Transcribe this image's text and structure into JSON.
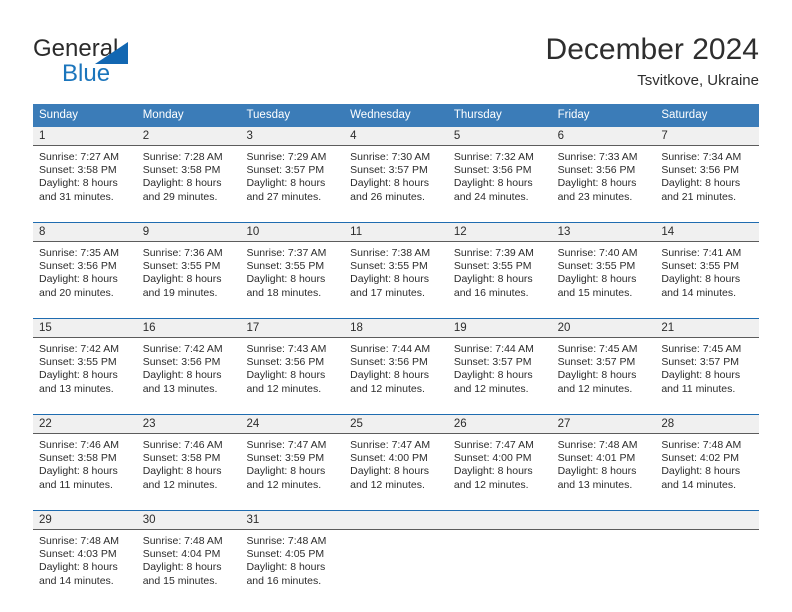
{
  "brand": {
    "name_top": "General",
    "name_bottom": "Blue",
    "accent_color": "#1b75bc",
    "triangle_color": "#1267b2"
  },
  "header": {
    "title": "December 2024",
    "location": "Tsvitkove, Ukraine"
  },
  "calendar": {
    "header_bg": "#3b7cb8",
    "weekdays": [
      "Sunday",
      "Monday",
      "Tuesday",
      "Wednesday",
      "Thursday",
      "Friday",
      "Saturday"
    ],
    "weeks": [
      [
        {
          "day": "1",
          "sunrise": "Sunrise: 7:27 AM",
          "sunset": "Sunset: 3:58 PM",
          "daylight1": "Daylight: 8 hours",
          "daylight2": "and 31 minutes."
        },
        {
          "day": "2",
          "sunrise": "Sunrise: 7:28 AM",
          "sunset": "Sunset: 3:58 PM",
          "daylight1": "Daylight: 8 hours",
          "daylight2": "and 29 minutes."
        },
        {
          "day": "3",
          "sunrise": "Sunrise: 7:29 AM",
          "sunset": "Sunset: 3:57 PM",
          "daylight1": "Daylight: 8 hours",
          "daylight2": "and 27 minutes."
        },
        {
          "day": "4",
          "sunrise": "Sunrise: 7:30 AM",
          "sunset": "Sunset: 3:57 PM",
          "daylight1": "Daylight: 8 hours",
          "daylight2": "and 26 minutes."
        },
        {
          "day": "5",
          "sunrise": "Sunrise: 7:32 AM",
          "sunset": "Sunset: 3:56 PM",
          "daylight1": "Daylight: 8 hours",
          "daylight2": "and 24 minutes."
        },
        {
          "day": "6",
          "sunrise": "Sunrise: 7:33 AM",
          "sunset": "Sunset: 3:56 PM",
          "daylight1": "Daylight: 8 hours",
          "daylight2": "and 23 minutes."
        },
        {
          "day": "7",
          "sunrise": "Sunrise: 7:34 AM",
          "sunset": "Sunset: 3:56 PM",
          "daylight1": "Daylight: 8 hours",
          "daylight2": "and 21 minutes."
        }
      ],
      [
        {
          "day": "8",
          "sunrise": "Sunrise: 7:35 AM",
          "sunset": "Sunset: 3:56 PM",
          "daylight1": "Daylight: 8 hours",
          "daylight2": "and 20 minutes."
        },
        {
          "day": "9",
          "sunrise": "Sunrise: 7:36 AM",
          "sunset": "Sunset: 3:55 PM",
          "daylight1": "Daylight: 8 hours",
          "daylight2": "and 19 minutes."
        },
        {
          "day": "10",
          "sunrise": "Sunrise: 7:37 AM",
          "sunset": "Sunset: 3:55 PM",
          "daylight1": "Daylight: 8 hours",
          "daylight2": "and 18 minutes."
        },
        {
          "day": "11",
          "sunrise": "Sunrise: 7:38 AM",
          "sunset": "Sunset: 3:55 PM",
          "daylight1": "Daylight: 8 hours",
          "daylight2": "and 17 minutes."
        },
        {
          "day": "12",
          "sunrise": "Sunrise: 7:39 AM",
          "sunset": "Sunset: 3:55 PM",
          "daylight1": "Daylight: 8 hours",
          "daylight2": "and 16 minutes."
        },
        {
          "day": "13",
          "sunrise": "Sunrise: 7:40 AM",
          "sunset": "Sunset: 3:55 PM",
          "daylight1": "Daylight: 8 hours",
          "daylight2": "and 15 minutes."
        },
        {
          "day": "14",
          "sunrise": "Sunrise: 7:41 AM",
          "sunset": "Sunset: 3:55 PM",
          "daylight1": "Daylight: 8 hours",
          "daylight2": "and 14 minutes."
        }
      ],
      [
        {
          "day": "15",
          "sunrise": "Sunrise: 7:42 AM",
          "sunset": "Sunset: 3:55 PM",
          "daylight1": "Daylight: 8 hours",
          "daylight2": "and 13 minutes."
        },
        {
          "day": "16",
          "sunrise": "Sunrise: 7:42 AM",
          "sunset": "Sunset: 3:56 PM",
          "daylight1": "Daylight: 8 hours",
          "daylight2": "and 13 minutes."
        },
        {
          "day": "17",
          "sunrise": "Sunrise: 7:43 AM",
          "sunset": "Sunset: 3:56 PM",
          "daylight1": "Daylight: 8 hours",
          "daylight2": "and 12 minutes."
        },
        {
          "day": "18",
          "sunrise": "Sunrise: 7:44 AM",
          "sunset": "Sunset: 3:56 PM",
          "daylight1": "Daylight: 8 hours",
          "daylight2": "and 12 minutes."
        },
        {
          "day": "19",
          "sunrise": "Sunrise: 7:44 AM",
          "sunset": "Sunset: 3:57 PM",
          "daylight1": "Daylight: 8 hours",
          "daylight2": "and 12 minutes."
        },
        {
          "day": "20",
          "sunrise": "Sunrise: 7:45 AM",
          "sunset": "Sunset: 3:57 PM",
          "daylight1": "Daylight: 8 hours",
          "daylight2": "and 12 minutes."
        },
        {
          "day": "21",
          "sunrise": "Sunrise: 7:45 AM",
          "sunset": "Sunset: 3:57 PM",
          "daylight1": "Daylight: 8 hours",
          "daylight2": "and 11 minutes."
        }
      ],
      [
        {
          "day": "22",
          "sunrise": "Sunrise: 7:46 AM",
          "sunset": "Sunset: 3:58 PM",
          "daylight1": "Daylight: 8 hours",
          "daylight2": "and 11 minutes."
        },
        {
          "day": "23",
          "sunrise": "Sunrise: 7:46 AM",
          "sunset": "Sunset: 3:58 PM",
          "daylight1": "Daylight: 8 hours",
          "daylight2": "and 12 minutes."
        },
        {
          "day": "24",
          "sunrise": "Sunrise: 7:47 AM",
          "sunset": "Sunset: 3:59 PM",
          "daylight1": "Daylight: 8 hours",
          "daylight2": "and 12 minutes."
        },
        {
          "day": "25",
          "sunrise": "Sunrise: 7:47 AM",
          "sunset": "Sunset: 4:00 PM",
          "daylight1": "Daylight: 8 hours",
          "daylight2": "and 12 minutes."
        },
        {
          "day": "26",
          "sunrise": "Sunrise: 7:47 AM",
          "sunset": "Sunset: 4:00 PM",
          "daylight1": "Daylight: 8 hours",
          "daylight2": "and 12 minutes."
        },
        {
          "day": "27",
          "sunrise": "Sunrise: 7:48 AM",
          "sunset": "Sunset: 4:01 PM",
          "daylight1": "Daylight: 8 hours",
          "daylight2": "and 13 minutes."
        },
        {
          "day": "28",
          "sunrise": "Sunrise: 7:48 AM",
          "sunset": "Sunset: 4:02 PM",
          "daylight1": "Daylight: 8 hours",
          "daylight2": "and 14 minutes."
        }
      ],
      [
        {
          "day": "29",
          "sunrise": "Sunrise: 7:48 AM",
          "sunset": "Sunset: 4:03 PM",
          "daylight1": "Daylight: 8 hours",
          "daylight2": "and 14 minutes."
        },
        {
          "day": "30",
          "sunrise": "Sunrise: 7:48 AM",
          "sunset": "Sunset: 4:04 PM",
          "daylight1": "Daylight: 8 hours",
          "daylight2": "and 15 minutes."
        },
        {
          "day": "31",
          "sunrise": "Sunrise: 7:48 AM",
          "sunset": "Sunset: 4:05 PM",
          "daylight1": "Daylight: 8 hours",
          "daylight2": "and 16 minutes."
        },
        {
          "day": "",
          "sunrise": "",
          "sunset": "",
          "daylight1": "",
          "daylight2": ""
        },
        {
          "day": "",
          "sunrise": "",
          "sunset": "",
          "daylight1": "",
          "daylight2": ""
        },
        {
          "day": "",
          "sunrise": "",
          "sunset": "",
          "daylight1": "",
          "daylight2": ""
        },
        {
          "day": "",
          "sunrise": "",
          "sunset": "",
          "daylight1": "",
          "daylight2": ""
        }
      ]
    ]
  }
}
